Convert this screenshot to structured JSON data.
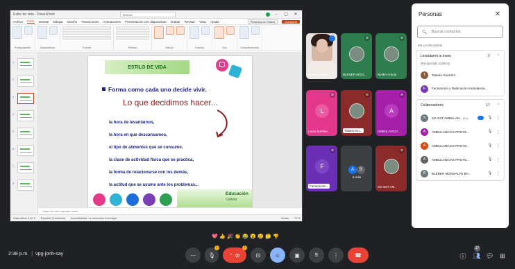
{
  "powerpoint": {
    "file_name": "Estilo de vida - PowerPoint",
    "search_placeholder": "Buscar",
    "menu": [
      "Archivo",
      "Inicio",
      "Insertar",
      "Dibujar",
      "Diseño",
      "Transiciones",
      "Animaciones",
      "Presentación con diapositivas",
      "Grabar",
      "Revisar",
      "Vista",
      "Ayuda"
    ],
    "active_menu_index": 1,
    "present_label": "Presentar en Teams",
    "share_label": "Compartir",
    "ribbon_groups": [
      "Portapapeles",
      "Diapositivas",
      "Fuente",
      "Párrafo",
      "Dibujo",
      "Edición",
      "Voz",
      "Complementos"
    ],
    "slide_numbers": [
      "1",
      "2",
      "3",
      "4",
      "5",
      "6",
      "7",
      "8"
    ],
    "selected_slide_index": 2,
    "slide": {
      "banner_title": "ESTILO DE VIDA",
      "heading": "Forma como cada uno decide vivir.",
      "subheading": "Lo que decidimos hacer...",
      "items": [
        "la hora de levantarnos,",
        "la hora en que descansamos,",
        "el tipo de alimentos que se consume,",
        "la clase de actividad física que se practica,",
        "la forma de relacionarse con los demás,",
        "la actitud que se asume ante los problemas..."
      ],
      "logo_line1": "Educación",
      "logo_line2": "Cultura",
      "circle_colors": [
        "#e43a8a",
        "#2eb3d6",
        "#1e6fd9",
        "#7b3fb5",
        "#2e9e4f"
      ]
    },
    "notes_placeholder": "Haga clic para agregar notas",
    "status_left": "Diapositiva 3 de 9",
    "status_lang": "Español (Colombia)",
    "status_accessibility": "Accesibilidad: es necesario investigar",
    "status_right": "Notas",
    "zoom": "70 %"
  },
  "tiles": [
    {
      "name": "Sasha Camila...",
      "kind": "video",
      "bg": "#e9e4e1"
    },
    {
      "name": "BLENER MON...",
      "kind": "photo",
      "bg": "#2e7d4f"
    },
    {
      "name": "Neider Araujo",
      "kind": "photo",
      "bg": "#2e7d4f"
    },
    {
      "name": "Laura Martine...",
      "kind": "avatar",
      "letter": "L",
      "bg": "#e3378b",
      "avatar_bg": "#ec5a9f"
    },
    {
      "name": "Tatiana Gu...",
      "kind": "photo",
      "bg": "#8b2a2a",
      "chip": true
    },
    {
      "name": "AMBULANCIA...",
      "kind": "avatar",
      "letter": "A",
      "bg": "#a51fa8",
      "avatar_bg": "#b83cbb"
    },
    {
      "name": "Facturación...",
      "kind": "avatar",
      "letter": "F",
      "bg": "#6a2fb5",
      "avatar_bg": "#7e46c6",
      "chip": true
    },
    {
      "name": "",
      "kind": "dual",
      "bg": "#3c4043",
      "sub": "8 más",
      "letters": [
        "A",
        "B"
      ]
    },
    {
      "name": "SG-SST AM...",
      "kind": "photo",
      "bg": "#8b2a2a"
    }
  ],
  "people": {
    "title": "Personas",
    "search_placeholder": "Buscar contactos",
    "in_meeting_label": "EN LA REUNIÓN",
    "raised_hands": {
      "label": "Levantaron la mano",
      "count": "2",
      "note": "(Recuperado al último)",
      "people": [
        {
          "name": "Tatiana Guerrero",
          "color": "#8b5a3c",
          "letter": "T"
        },
        {
          "name": "Facturación y Radicación Ambulancia...",
          "color": "#7b3fb5",
          "letter": "F"
        }
      ]
    },
    "collaborators": {
      "label": "Colaboradores",
      "count": "17",
      "people": [
        {
          "name": "SG-SST AMBULAN...",
          "tag": "(Tú)",
          "color": "#6b7a7f",
          "letter": "S",
          "badge": true
        },
        {
          "name": "AMBULANCIAS PROYE...",
          "color": "#a51fa8",
          "letter": "A"
        },
        {
          "name": "AMBULANCIAS PROYE...",
          "color": "#d9480f",
          "letter": "A"
        },
        {
          "name": "AMBULANCIAS PROYE...",
          "color": "#5f6368",
          "letter": "A"
        },
        {
          "name": "BLENER MONSALVO BA...",
          "color": "#6b7a7f",
          "letter": "B"
        }
      ]
    }
  },
  "reactions": [
    "💖",
    "👍",
    "🎉",
    "👏",
    "😂",
    "😮",
    "😢",
    "🤔",
    "👎"
  ],
  "bottom": {
    "time": "2:38 p.m.",
    "meeting_code": "vpg-jonh-say",
    "people_count": "17"
  }
}
